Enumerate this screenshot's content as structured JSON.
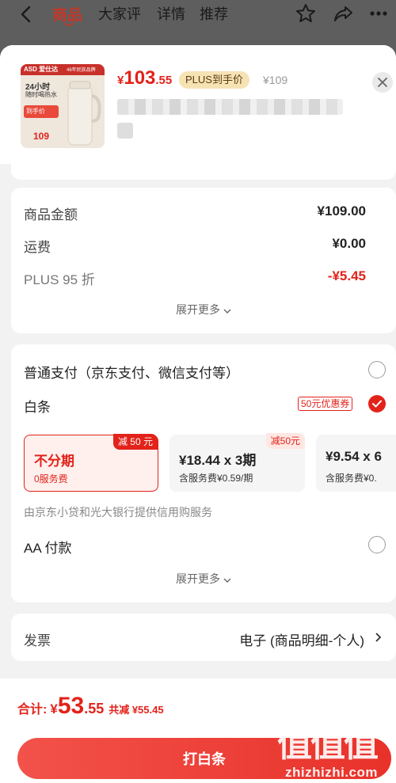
{
  "nav": {
    "tabs": [
      "商品",
      "大家评",
      "详情",
      "推荐"
    ]
  },
  "product": {
    "thumb": {
      "brand": "ASD 爱仕达",
      "brand_badge": "46年民族品牌",
      "headline_1": "24小时",
      "headline_2": "随时喝热水",
      "promo": "到手价",
      "price": "109"
    },
    "price_yen": "¥",
    "price_int": "103",
    "price_dec": ".55",
    "plus_badge": "PLUS到手价",
    "original_price": "¥109"
  },
  "summary": {
    "rows": [
      {
        "label": "商品金额",
        "value": "¥109.00"
      },
      {
        "label": "运费",
        "value": "¥0.00"
      },
      {
        "label": "PLUS 95 折",
        "value": "-¥5.45"
      }
    ],
    "more": "展开更多"
  },
  "payment": {
    "options": [
      {
        "label": "普通支付（京东支付、微信支付等）"
      },
      {
        "label": "白条",
        "coupon": "50元优惠券"
      },
      {
        "label": "AA 付款"
      }
    ],
    "installments": [
      {
        "title": "不分期",
        "sub": "0服务费",
        "tag": "减 50 元"
      },
      {
        "title": "¥18.44 x 3期",
        "sub": "含服务费¥0.59/期",
        "tag": "减50元"
      },
      {
        "title": "¥9.54 x 6",
        "sub": "含服务费¥0.",
        "tag": ""
      }
    ],
    "note": "由京东小贷和光大银行提供信用购服务",
    "more": "展开更多"
  },
  "invoice": {
    "label": "发票",
    "value": "电子 (商品明细-个人)"
  },
  "footer": {
    "total_label": "合计:",
    "total_yen": "¥",
    "total_int": "53",
    "total_dec": ".55",
    "saved": "共减 ¥55.45",
    "pay_button": "打白条"
  },
  "watermark": {
    "chars": "值值值",
    "url": "zhizhizhi.com"
  },
  "colors": {
    "accent": "#e2231a",
    "plus_badge_bg": "#f6e3b4"
  }
}
